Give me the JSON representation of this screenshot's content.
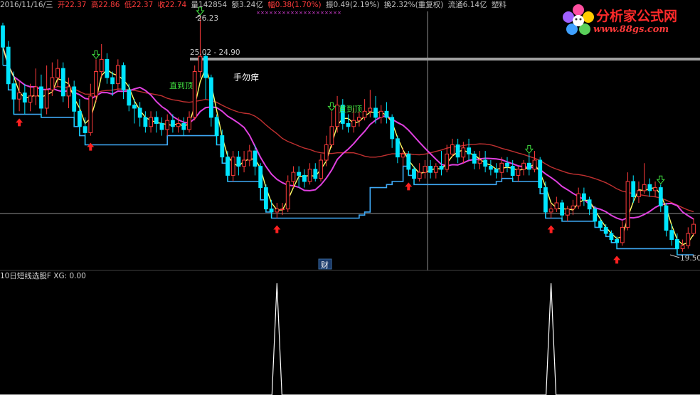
{
  "header": {
    "date": "2016/11/16/三",
    "open": "开22.37",
    "high": "高22.86",
    "low": "低22.37",
    "close": "收22.74",
    "volume": "量142854",
    "amount": "额3.24亿",
    "change": "幅0.38(1.70%)",
    "amplitude": "振0.49(2.19%)",
    "turnover": "换2.32%(重复权)",
    "float_cap": "流通6.14亿",
    "sector": "塑料"
  },
  "logo": {
    "title": "分析家公式网",
    "url": "www.88gs.com"
  },
  "annotations": {
    "high_label": "26.23",
    "range_label": "25.02 - 24.90",
    "center_text": "手勿痒",
    "label_a": "直到顶",
    "label_b": "直到顶",
    "low_label": "19.50",
    "badge": "财"
  },
  "indicator": {
    "title": "10日短线选股F",
    "xg_label": "XG: 0.00"
  },
  "colors": {
    "bull": "#ff3b3b",
    "bear": "#00e5ff",
    "ma_short": "#ffff66",
    "ma_mid": "#e040e0",
    "ma_long": "#c03030",
    "support": "#3fa9f5",
    "signal_buy": "#ff2020",
    "signal_sell": "#40e040",
    "grid": "#909090"
  },
  "chart_data": {
    "type": "candlestick",
    "price_range": [
      19.5,
      26.23
    ],
    "candles": [
      [
        25.9,
        25.2,
        26.0,
        24.6
      ],
      [
        25.2,
        24.0,
        25.4,
        23.8
      ],
      [
        24.0,
        23.5,
        24.4,
        23.0
      ],
      [
        23.5,
        23.7,
        24.1,
        23.1
      ],
      [
        23.7,
        23.4,
        24.0,
        23.0
      ],
      [
        23.4,
        23.6,
        24.0,
        23.1
      ],
      [
        23.6,
        23.9,
        24.5,
        23.3
      ],
      [
        23.9,
        23.2,
        24.3,
        22.9
      ],
      [
        23.2,
        23.8,
        24.6,
        23.0
      ],
      [
        23.8,
        24.2,
        24.7,
        23.6
      ],
      [
        24.2,
        24.5,
        24.8,
        23.9
      ],
      [
        24.5,
        23.6,
        24.7,
        23.4
      ],
      [
        23.6,
        23.9,
        24.2,
        23.2
      ],
      [
        23.9,
        23.1,
        24.1,
        22.6
      ],
      [
        23.1,
        22.6,
        23.5,
        22.3
      ],
      [
        22.6,
        22.4,
        22.9,
        22.0
      ],
      [
        22.4,
        23.6,
        24.0,
        22.3
      ],
      [
        23.6,
        24.4,
        24.8,
        23.4
      ],
      [
        24.4,
        24.8,
        25.3,
        24.2
      ],
      [
        24.8,
        24.2,
        25.0,
        24.0
      ],
      [
        24.2,
        24.0,
        24.4,
        23.6
      ],
      [
        24.0,
        24.6,
        24.8,
        23.8
      ],
      [
        24.6,
        23.8,
        24.7,
        23.5
      ],
      [
        23.8,
        23.3,
        24.0,
        23.1
      ],
      [
        23.3,
        23.2,
        23.5,
        22.7
      ],
      [
        23.2,
        22.9,
        23.4,
        22.6
      ],
      [
        22.9,
        22.6,
        23.1,
        22.4
      ],
      [
        22.6,
        22.9,
        23.1,
        22.4
      ],
      [
        22.9,
        22.7,
        23.1,
        22.4
      ],
      [
        22.7,
        22.5,
        22.9,
        22.3
      ],
      [
        22.5,
        22.8,
        23.0,
        22.3
      ],
      [
        22.8,
        22.6,
        23.0,
        22.4
      ],
      [
        22.6,
        22.7,
        22.9,
        22.4
      ],
      [
        22.7,
        22.5,
        22.9,
        22.3
      ],
      [
        22.5,
        22.9,
        23.1,
        22.4
      ],
      [
        22.9,
        24.4,
        24.6,
        22.8
      ],
      [
        24.4,
        24.9,
        26.23,
        24.2
      ],
      [
        24.9,
        24.2,
        25.0,
        23.5
      ],
      [
        24.2,
        22.9,
        24.3,
        22.6
      ],
      [
        22.9,
        22.3,
        23.0,
        22.0
      ],
      [
        22.3,
        21.6,
        22.5,
        21.4
      ],
      [
        21.6,
        21.0,
        21.8,
        20.8
      ],
      [
        21.0,
        21.6,
        21.8,
        20.8
      ],
      [
        21.6,
        21.3,
        21.8,
        21.0
      ],
      [
        21.3,
        21.5,
        21.8,
        21.1
      ],
      [
        21.5,
        21.8,
        22.0,
        21.3
      ],
      [
        21.8,
        21.3,
        22.0,
        21.0
      ],
      [
        21.3,
        20.6,
        21.4,
        20.2
      ],
      [
        20.6,
        19.9,
        20.7,
        19.8
      ],
      [
        19.9,
        19.8,
        20.2,
        19.6
      ],
      [
        19.8,
        19.9,
        20.1,
        19.6
      ],
      [
        19.9,
        19.9,
        20.1,
        19.7
      ],
      [
        19.9,
        20.8,
        21.0,
        19.8
      ],
      [
        20.8,
        21.1,
        21.3,
        20.6
      ],
      [
        21.1,
        21.0,
        21.3,
        20.6
      ],
      [
        21.0,
        20.8,
        21.2,
        20.6
      ],
      [
        20.8,
        21.2,
        21.4,
        20.7
      ],
      [
        21.2,
        20.9,
        21.4,
        20.8
      ],
      [
        20.9,
        21.5,
        21.7,
        20.8
      ],
      [
        21.5,
        22.0,
        22.3,
        21.3
      ],
      [
        22.0,
        22.6,
        23.1,
        21.9
      ],
      [
        22.6,
        23.3,
        23.6,
        22.4
      ],
      [
        23.3,
        22.7,
        23.5,
        22.5
      ],
      [
        22.7,
        22.6,
        23.0,
        22.4
      ],
      [
        22.6,
        22.8,
        23.2,
        22.4
      ],
      [
        22.8,
        22.9,
        23.1,
        22.6
      ],
      [
        22.9,
        23.1,
        23.5,
        22.8
      ],
      [
        23.1,
        23.2,
        23.8,
        22.9
      ],
      [
        23.2,
        22.9,
        23.6,
        22.7
      ],
      [
        22.9,
        23.1,
        23.3,
        22.7
      ],
      [
        23.1,
        22.9,
        23.4,
        22.7
      ],
      [
        22.9,
        22.2,
        23.0,
        21.9
      ],
      [
        22.2,
        21.6,
        22.3,
        21.4
      ],
      [
        21.6,
        21.7,
        21.9,
        21.3
      ],
      [
        21.7,
        21.2,
        21.8,
        21.0
      ],
      [
        21.2,
        20.9,
        21.3,
        20.7
      ],
      [
        20.9,
        21.1,
        21.4,
        20.8
      ],
      [
        21.1,
        21.3,
        21.5,
        20.9
      ],
      [
        21.3,
        21.1,
        21.5,
        20.9
      ],
      [
        21.1,
        21.3,
        21.4,
        20.9
      ],
      [
        21.3,
        21.2,
        21.8,
        21.0
      ],
      [
        21.2,
        21.7,
        22.0,
        21.1
      ],
      [
        21.7,
        22.0,
        22.2,
        21.6
      ],
      [
        22.0,
        21.6,
        22.2,
        21.4
      ],
      [
        21.6,
        21.9,
        22.1,
        21.4
      ],
      [
        21.9,
        21.7,
        22.2,
        21.5
      ],
      [
        21.7,
        21.4,
        21.8,
        21.2
      ],
      [
        21.4,
        21.5,
        21.8,
        21.2
      ],
      [
        21.5,
        21.3,
        21.8,
        21.1
      ],
      [
        21.3,
        21.2,
        21.5,
        21.0
      ],
      [
        21.2,
        21.1,
        21.4,
        20.9
      ],
      [
        21.1,
        21.4,
        21.6,
        20.9
      ],
      [
        21.4,
        21.3,
        21.6,
        21.1
      ],
      [
        21.3,
        21.0,
        21.5,
        20.8
      ],
      [
        21.0,
        21.2,
        21.3,
        20.8
      ],
      [
        21.2,
        21.4,
        21.5,
        21.0
      ],
      [
        21.4,
        21.2,
        21.7,
        21.0
      ],
      [
        21.2,
        21.5,
        21.8,
        21.1
      ],
      [
        21.5,
        20.6,
        21.6,
        20.4
      ],
      [
        20.6,
        19.8,
        20.8,
        19.6
      ],
      [
        19.8,
        19.9,
        20.1,
        19.6
      ],
      [
        19.9,
        20.1,
        20.3,
        19.8
      ],
      [
        20.1,
        19.7,
        20.2,
        19.5
      ],
      [
        19.7,
        19.9,
        20.0,
        19.5
      ],
      [
        19.9,
        20.0,
        20.2,
        19.7
      ],
      [
        20.0,
        20.4,
        20.6,
        19.9
      ],
      [
        20.4,
        20.2,
        20.6,
        20.0
      ],
      [
        20.2,
        19.9,
        20.3,
        19.7
      ],
      [
        19.9,
        19.5,
        20.0,
        19.3
      ],
      [
        19.5,
        19.3,
        19.6,
        19.2
      ],
      [
        19.3,
        19.1,
        19.4,
        19.0
      ],
      [
        19.1,
        18.9,
        19.2,
        18.8
      ],
      [
        18.9,
        18.8,
        19.0,
        18.6
      ],
      [
        18.8,
        19.3,
        19.5,
        18.7
      ],
      [
        19.3,
        20.8,
        21.1,
        19.2
      ],
      [
        20.8,
        20.3,
        21.0,
        20.1
      ],
      [
        20.3,
        20.5,
        20.8,
        20.1
      ],
      [
        20.5,
        20.7,
        21.4,
        20.4
      ],
      [
        20.7,
        20.5,
        20.9,
        20.3
      ],
      [
        20.5,
        20.6,
        20.8,
        20.3
      ],
      [
        20.6,
        20.0,
        20.7,
        19.8
      ],
      [
        20.0,
        19.2,
        20.1,
        19.0
      ],
      [
        19.2,
        18.9,
        19.4,
        18.7
      ],
      [
        18.9,
        18.6,
        19.1,
        18.4
      ],
      [
        18.6,
        18.7,
        18.9,
        18.5
      ],
      [
        18.7,
        19.1,
        19.3,
        18.6
      ],
      [
        19.1,
        19.4,
        19.6,
        19.0
      ]
    ],
    "signal_days": [
      3,
      16,
      50,
      74,
      100,
      112
    ],
    "indicator_name": "XG",
    "indicator_value": 0.0,
    "indicator_spikes_at": [
      50,
      100
    ]
  }
}
